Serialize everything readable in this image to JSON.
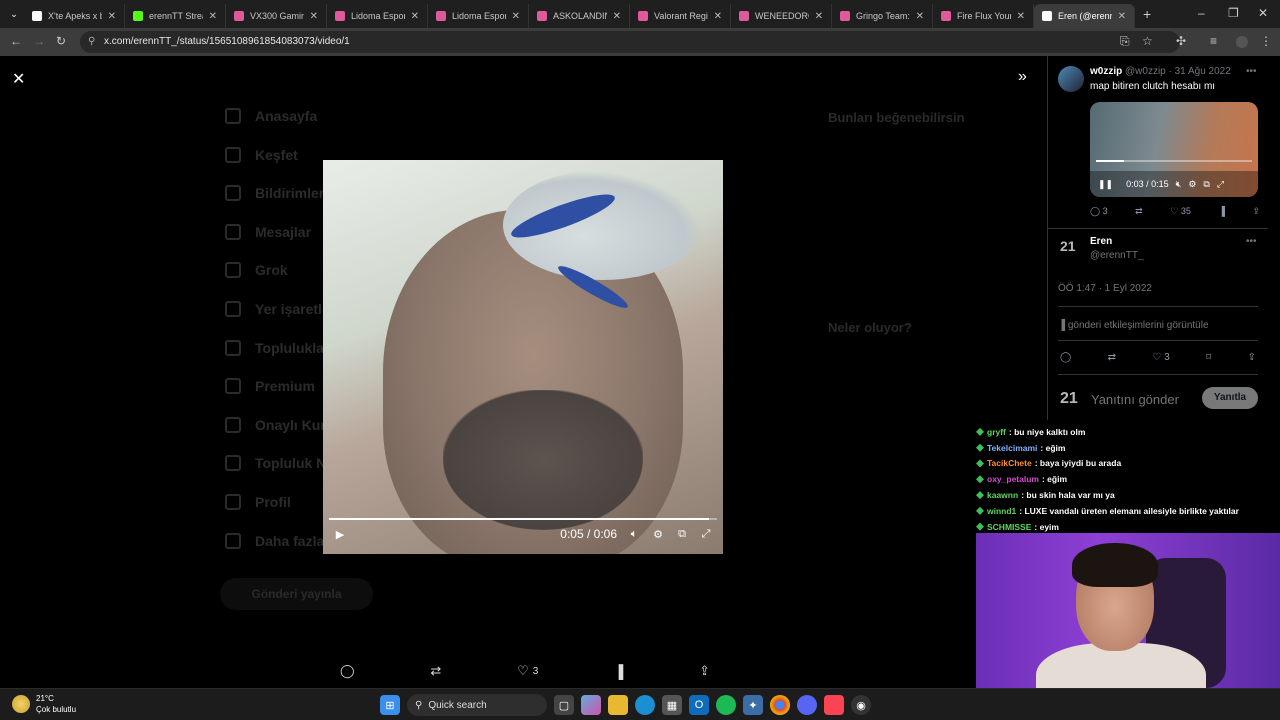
{
  "tabs": [
    {
      "title": "X'te Apeks x b",
      "color": "#ffffff"
    },
    {
      "title": "erennTT Stream",
      "color": "#53fc18"
    },
    {
      "title": "VX300 Gaming",
      "color": "#e05a9a"
    },
    {
      "title": "Lidoma Esports",
      "color": "#e05a9a"
    },
    {
      "title": "Lidoma Esports",
      "color": "#e05a9a"
    },
    {
      "title": "ASKOLANDIN",
      "color": "#e05a9a"
    },
    {
      "title": "Valorant Region",
      "color": "#e05a9a"
    },
    {
      "title": "WENEEDORG",
      "color": "#e05a9a"
    },
    {
      "title": "Gringo Team: M",
      "color": "#e05a9a"
    },
    {
      "title": "Fire Flux Young",
      "color": "#e05a9a"
    },
    {
      "title": "Eren (@erenn",
      "color": "#ffffff"
    }
  ],
  "url": "x.com/erennTT_/status/1565108961854083073/video/1",
  "background_nav": [
    "Anasayfa",
    "Keşfet",
    "Bildirimler",
    "Mesajlar",
    "Grok",
    "Yer işaretleri",
    "Topluluklar",
    "Premium",
    "Onaylı Kuruluşlar",
    "Topluluk Notları",
    "Profil",
    "Daha fazla"
  ],
  "background_post_button": "Gönderi yayınla",
  "background_right": {
    "suggest": "Bunları beğenebilirsin",
    "trends": "Neler oluyor?"
  },
  "main_video": {
    "time": "0:05 / 0:06",
    "progress": 0.98
  },
  "action_bar": {
    "likes": "3"
  },
  "tweet1": {
    "name": "w0zzip",
    "handle": "@w0zzip",
    "date": "· 31 Ağu 2022",
    "text": "map bitiren clutch hesabı mı",
    "video_time": "0:03 / 0:15",
    "video_progress": 0.18,
    "replies": "3",
    "likes": "35"
  },
  "tweet2": {
    "name": "Eren",
    "handle": "@erennTT_",
    "timestamp": "ÖÖ 1:47 · 1 Eyl 2022",
    "engagement": "gönderi etkileşimlerini görüntüle",
    "likes": "3",
    "reply_placeholder": "Yanıtını gönder",
    "reply_button": "Yanıtla"
  },
  "chat": [
    {
      "user": "gryff",
      "color": "#5cd65c",
      "msg": " : bu niye kalktı olm"
    },
    {
      "user": "Tekelcimami",
      "color": "#7fb2ff",
      "msg": " : eğim"
    },
    {
      "user": "TacikChete",
      "color": "#ff8c3a",
      "msg": " : baya iyiydi bu arada"
    },
    {
      "user": "oxy_petalum",
      "color": "#d24bd2",
      "msg": " : eğim"
    },
    {
      "user": "kaawnn",
      "color": "#5cd65c",
      "msg": " : bu skin hala var mı ya"
    },
    {
      "user": "winnd1",
      "color": "#5cd65c",
      "msg": " : LUXE vandalı üreten elemanı ailesiyle birlikte yaktılar"
    },
    {
      "user": "SCHMISSE",
      "color": "#5cd65c",
      "msg": " : eyim"
    }
  ],
  "taskbar": {
    "temp": "21°C",
    "weather": "Çok bulutlu",
    "search": "Quick search"
  }
}
